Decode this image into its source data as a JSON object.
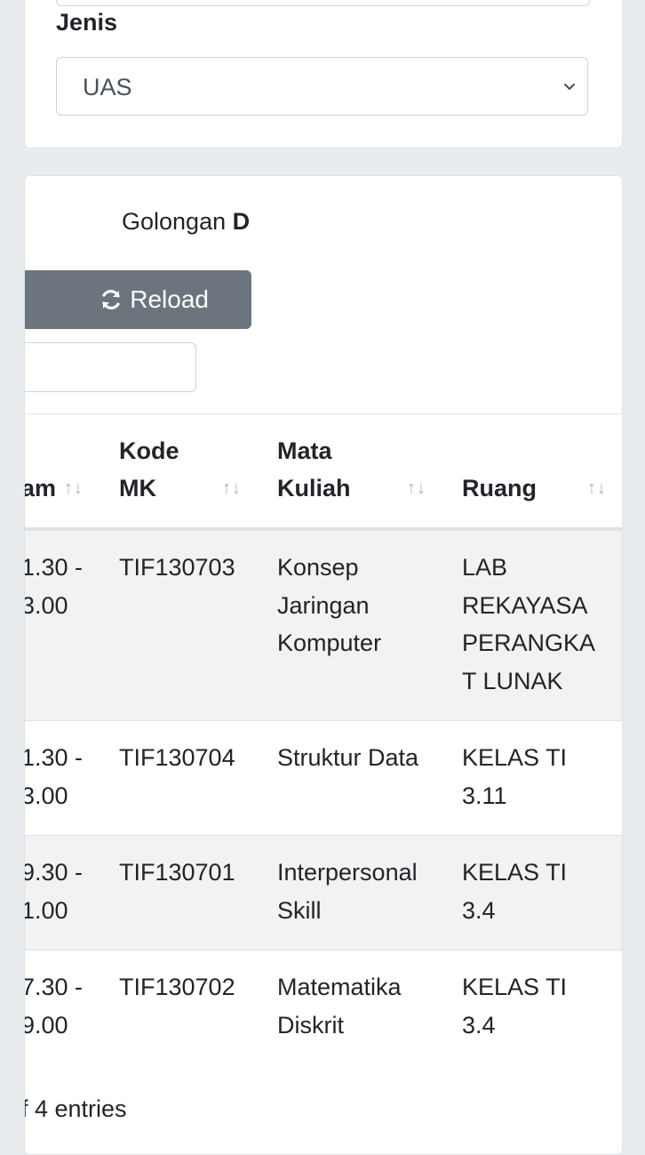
{
  "filter": {
    "jenis_label": "Jenis",
    "jenis_value": "UAS"
  },
  "header": {
    "golongan_label": "Golongan",
    "golongan_value": "D"
  },
  "toolbar": {
    "reload_label": "Reload"
  },
  "table": {
    "columns": [
      {
        "label": "am"
      },
      {
        "label_line1": "Kode",
        "label_line2": "MK"
      },
      {
        "label_line1": "Mata",
        "label_line2": "Kuliah"
      },
      {
        "label": "Ruang"
      }
    ],
    "rows": [
      {
        "jam1": "1.30 -",
        "jam2": "3.00",
        "kode": "TIF130703",
        "mk1": "Konsep",
        "mk2": "Jaringan",
        "mk3": "Komputer",
        "ruang1": "LAB",
        "ruang2": "REKAYASA",
        "ruang3": "PERANGKA",
        "ruang4": "T LUNAK"
      },
      {
        "jam1": "1.30 -",
        "jam2": "3.00",
        "kode": "TIF130704",
        "mk1": "Struktur Data",
        "ruang1": "KELAS TI",
        "ruang2": "3.11"
      },
      {
        "jam1": "9.30 -",
        "jam2": "1.00",
        "kode": "TIF130701",
        "mk1": "Interpersonal",
        "mk2": "Skill",
        "ruang1": "KELAS TI",
        "ruang2": "3.4"
      },
      {
        "jam1": "7.30 -",
        "jam2": "9.00",
        "kode": "TIF130702",
        "mk1": "Matematika",
        "mk2": "Diskrit",
        "ruang1": "KELAS TI",
        "ruang2": "3.4"
      }
    ],
    "sort_icon": "↑↓"
  },
  "footer": {
    "entries_text": "f 4 entries"
  },
  "icons": {
    "reload": "sync-icon",
    "select": "chevron-down-icon"
  }
}
